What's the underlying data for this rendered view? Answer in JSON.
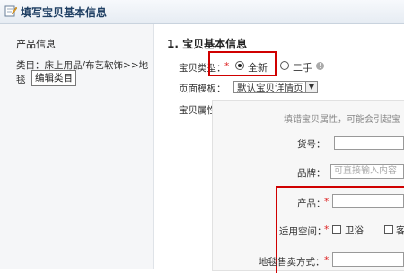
{
  "header": {
    "title": "填写宝贝基本信息",
    "icon": "edit-document-icon"
  },
  "sidebar": {
    "heading": "产品信息",
    "category_text": "类目：床上用品/布艺软饰>>地毯",
    "edit_button": "编辑类目"
  },
  "form": {
    "section_title": "1. 宝贝基本信息",
    "item_type": {
      "label": "宝贝类型：",
      "required_mark": "*",
      "options": [
        "全新",
        "二手"
      ],
      "selected": "全新"
    },
    "page_template": {
      "label": "页面模板：",
      "value": "默认宝贝详情页"
    },
    "attributes": {
      "label": "宝贝属性：",
      "hint": "填错宝贝属性，可能会引起宝",
      "fields": {
        "item_no": {
          "label": "货号："
        },
        "brand": {
          "label": "品牌：",
          "placeholder": "可直接输入内容"
        },
        "product": {
          "label": "产品：",
          "required_mark": "*"
        },
        "space": {
          "label": "适用空间：",
          "required_mark": "*",
          "options": [
            "卫浴",
            "客"
          ]
        },
        "sale_method": {
          "label": "地毯售卖方式：",
          "required_mark": "*"
        }
      }
    }
  },
  "colors": {
    "highlight_red": "#d00000",
    "header_text": "#1f3f63"
  }
}
